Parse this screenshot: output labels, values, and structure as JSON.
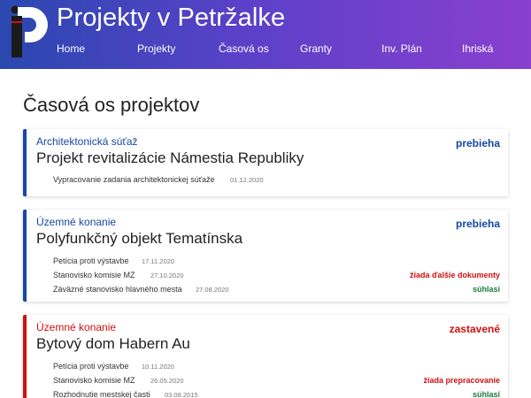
{
  "header": {
    "title": "Projekty v Petržalke",
    "nav": [
      "Home",
      "Projekty",
      "Časová os",
      "Granty",
      "Inv. Plán",
      "Ihriská"
    ]
  },
  "page": {
    "title": "Časová os projektov"
  },
  "colors": {
    "accent_blue": "#1646a6",
    "stopped_red": "#d01010",
    "positive_green": "#1a7a3c",
    "header_gradient_start": "#2a48b0",
    "header_gradient_end": "#8a3fcf"
  },
  "projects": [
    {
      "type": "Architektonická súťaž",
      "status": "prebieha",
      "title": "Projekt revitalizácie Námestia Republiky",
      "events": [
        {
          "name": "Vypracovanie zadania architektonickej súťaže",
          "date": "01.12.2020",
          "outcome": ""
        }
      ]
    },
    {
      "type": "Územné konanie",
      "status": "prebieha",
      "title": "Polyfunkčný objekt Tematínska",
      "events": [
        {
          "name": "Petícia proti výstavbe",
          "date": "17.11.2020",
          "outcome": ""
        },
        {
          "name": "Stanovisko komisie MZ",
          "date": "27.10.2020",
          "outcome": "žiada ďalšie dokumenty"
        },
        {
          "name": "Záväzné stanovisko hlavného mesta",
          "date": "27.08.2020",
          "outcome": "súhlasí"
        }
      ]
    },
    {
      "type": "Územné konanie",
      "status": "zastavené",
      "title": "Bytový dom Habern Au",
      "events": [
        {
          "name": "Petícia proti výstavbe",
          "date": "10.11.2020",
          "outcome": ""
        },
        {
          "name": "Stanovisko komisie MZ",
          "date": "26.05.2020",
          "outcome": "žiada prepracovanie"
        },
        {
          "name": "Rozhodnutie mestskej časti",
          "date": "03.08.2015",
          "outcome": "súhlasí"
        }
      ]
    }
  ]
}
